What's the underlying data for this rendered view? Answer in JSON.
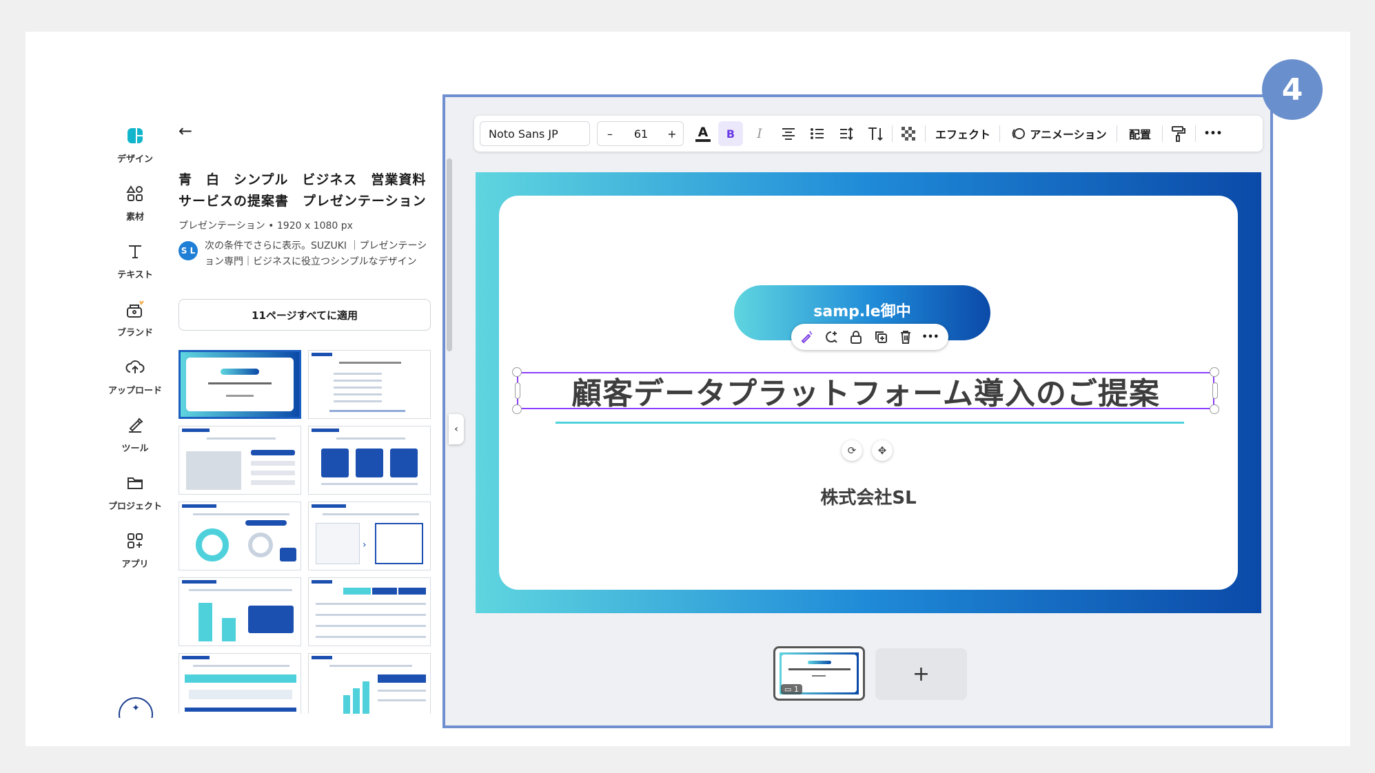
{
  "step_badge": "4",
  "rail": {
    "items": [
      {
        "label": "デザイン",
        "icon": "design-icon"
      },
      {
        "label": "素材",
        "icon": "elements-icon"
      },
      {
        "label": "テキスト",
        "icon": "text-icon"
      },
      {
        "label": "ブランド",
        "icon": "brand-icon"
      },
      {
        "label": "アップロード",
        "icon": "upload-icon"
      },
      {
        "label": "ツール",
        "icon": "tools-icon"
      },
      {
        "label": "プロジェクト",
        "icon": "folder-icon"
      },
      {
        "label": "アプリ",
        "icon": "apps-icon"
      }
    ]
  },
  "panel": {
    "title": "青　白　シンプル　ビジネス　営業資料　サービスの提案書　プレゼンテーション",
    "meta": "プレゼンテーション • 1920 x 1080 px",
    "author_initials": "S L",
    "author_text": "次の条件でさらに表示。SUZUKI ｜プレゼンテーション専門｜ビジネスに役立つシンプルなデザイン",
    "apply_label": "11ページすべてに適用"
  },
  "toolbar": {
    "font": "Noto Sans JP",
    "size_minus": "–",
    "size": "61",
    "size_plus": "+",
    "text_color": "A",
    "bold": "B",
    "italic": "I",
    "effect": "エフェクト",
    "animation": "アニメーション",
    "position": "配置",
    "more": "•••"
  },
  "slide": {
    "pill_text": "samp.le御中",
    "title": "顧客データプラットフォーム導入のご提案",
    "company": "株式会社SL"
  },
  "pages": {
    "current": "1",
    "add": "+"
  },
  "colors": {
    "accent": "#8b3dff",
    "brand_blue": "#0b4aa8",
    "cyan": "#5fd5df",
    "frame": "#6f8fd0"
  }
}
